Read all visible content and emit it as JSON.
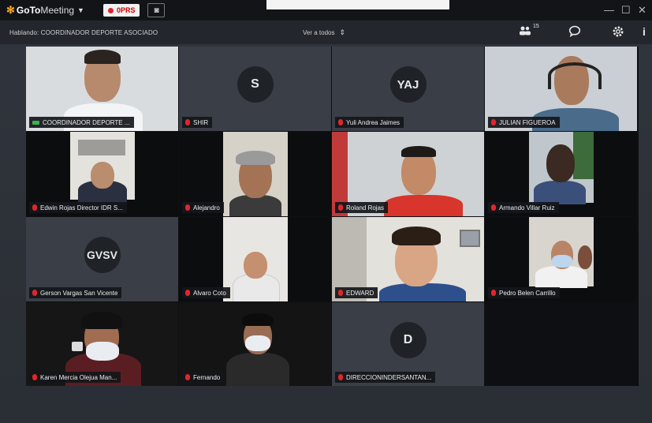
{
  "titlebar": {
    "app_name": "GoTo",
    "app_name_suffix": "Meeting",
    "rec_label": "0PRS",
    "window_controls": [
      "—",
      "☐",
      "✕"
    ]
  },
  "toolbar": {
    "speaking": "Hablando: COORDINADOR DEPORTE ASOCIADO",
    "view_all": "Ver a todos",
    "attendee_count": "15"
  },
  "participants": [
    {
      "name": "COORDINADOR DEPORTE ...",
      "initials": "",
      "mic": "on"
    },
    {
      "name": "SHIR",
      "initials": "S",
      "mic": "muted"
    },
    {
      "name": "Yuli Andrea Jaimes",
      "initials": "YAJ",
      "mic": "muted"
    },
    {
      "name": "JULIAN FIGUEROA",
      "initials": "",
      "mic": "muted"
    },
    {
      "name": "Edwin Rojas Director IDR S...",
      "initials": "",
      "mic": "muted"
    },
    {
      "name": "Alejandro",
      "initials": "",
      "mic": "muted"
    },
    {
      "name": "Roland Rojas",
      "initials": "",
      "mic": "muted"
    },
    {
      "name": "Armando Villar Ruiz",
      "initials": "",
      "mic": "muted"
    },
    {
      "name": "Gerson Vargas San Vicente",
      "initials": "GVSV",
      "mic": "muted"
    },
    {
      "name": "Alvaro Coto",
      "initials": "",
      "mic": "muted"
    },
    {
      "name": "EDWARD",
      "initials": "",
      "mic": "muted"
    },
    {
      "name": "Pedro Belen Carrillo",
      "initials": "",
      "mic": "muted"
    },
    {
      "name": "Karen Mercia Olejua Man...",
      "initials": "",
      "mic": "muted"
    },
    {
      "name": "Fernando",
      "initials": "",
      "mic": "muted"
    },
    {
      "name": "DIRECCIONINDERSANTAN...",
      "initials": "D",
      "mic": "muted"
    }
  ],
  "colors": {
    "accent": "#f5a623",
    "muted_mic": "#e0262b",
    "active_mic": "#3ab54a"
  }
}
